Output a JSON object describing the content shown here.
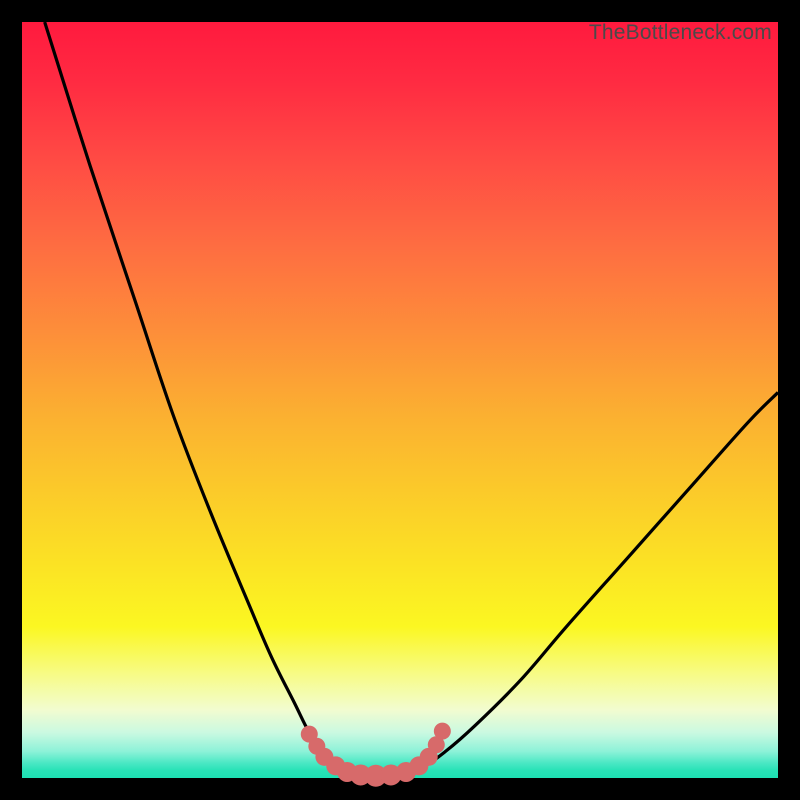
{
  "watermark": "TheBottleneck.com",
  "colors": {
    "background": "#000000",
    "gradient_top": "#ff1a3e",
    "gradient_mid": "#fbca2a",
    "gradient_bottom": "#1de0b3",
    "curve_stroke": "#000000",
    "marker_fill": "#d76a6a",
    "marker_stroke": "#c95a5a"
  },
  "chart_data": {
    "type": "line",
    "title": "",
    "xlabel": "",
    "ylabel": "",
    "x": [
      0.03,
      0.09,
      0.15,
      0.2,
      0.25,
      0.3,
      0.33,
      0.36,
      0.38,
      0.4,
      0.42,
      0.44,
      0.46,
      0.48,
      0.5,
      0.53,
      0.56,
      0.6,
      0.66,
      0.72,
      0.8,
      0.88,
      0.96,
      1.0
    ],
    "y": [
      1.0,
      0.81,
      0.63,
      0.48,
      0.35,
      0.23,
      0.16,
      0.1,
      0.06,
      0.03,
      0.015,
      0.008,
      0.004,
      0.004,
      0.008,
      0.015,
      0.035,
      0.07,
      0.13,
      0.2,
      0.29,
      0.38,
      0.47,
      0.51
    ],
    "xlim": [
      0,
      1
    ],
    "ylim": [
      0,
      1
    ],
    "grid": false,
    "legend": false,
    "markers": {
      "x": [
        0.38,
        0.39,
        0.4,
        0.415,
        0.43,
        0.448,
        0.468,
        0.488,
        0.508,
        0.525,
        0.538,
        0.548,
        0.556
      ],
      "y": [
        0.058,
        0.042,
        0.028,
        0.016,
        0.008,
        0.004,
        0.003,
        0.004,
        0.008,
        0.016,
        0.028,
        0.044,
        0.062
      ],
      "r": [
        8.5,
        8.5,
        9.0,
        9.5,
        10.0,
        10.5,
        11.0,
        10.5,
        10.0,
        9.5,
        9.0,
        8.5,
        8.5
      ]
    }
  }
}
